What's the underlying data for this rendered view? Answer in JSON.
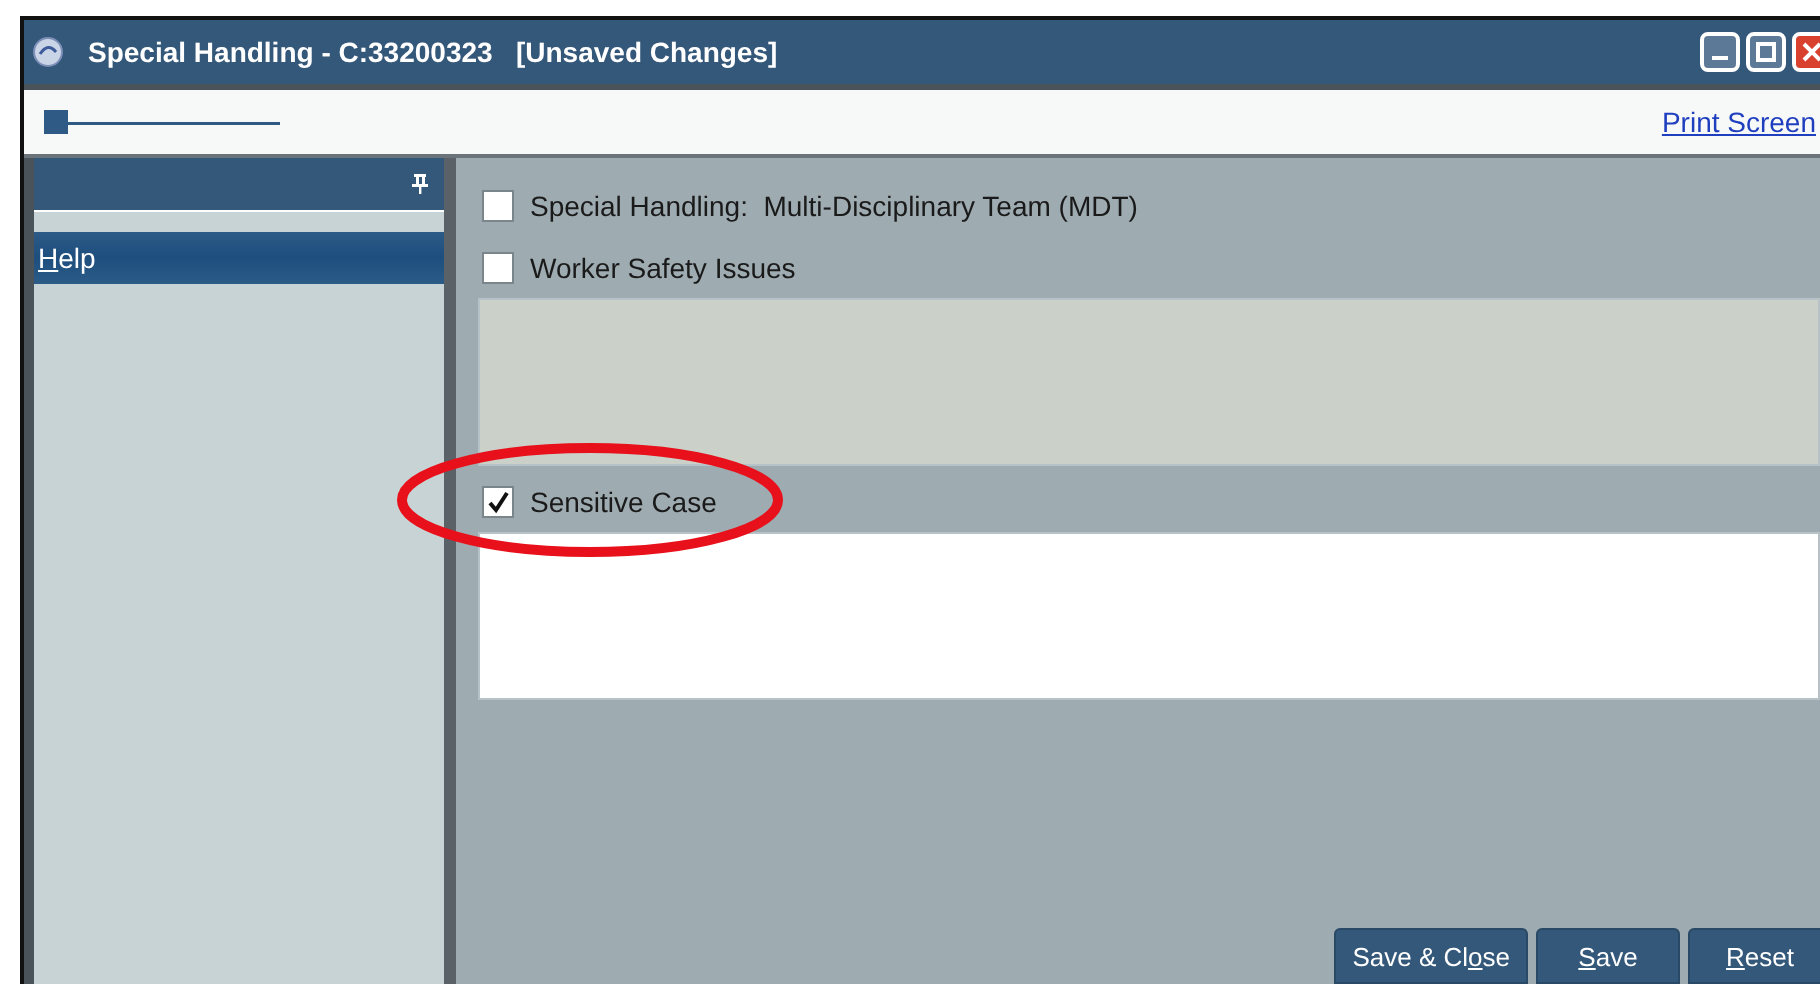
{
  "window": {
    "title": "Special Handling - C:33200323   [Unsaved Changes]"
  },
  "toolbar": {
    "link": "Print Screen"
  },
  "sidebar": {
    "items": [
      {
        "segments": [
          {
            "text": "H",
            "underlined": true
          },
          {
            "text": "elp",
            "underlined": false
          }
        ],
        "selected": true
      }
    ]
  },
  "options": [
    {
      "kind": "checkbox",
      "label": "Special Handling:  Multi-Disciplinary Team (MDT)",
      "checked": false
    },
    {
      "kind": "checkbox",
      "label": "Worker Safety Issues",
      "checked": false
    },
    {
      "kind": "textarea",
      "color": "#cbd0c8"
    },
    {
      "kind": "checkbox",
      "label": "Sensitive Case",
      "checked": true,
      "highlighted": true
    },
    {
      "kind": "textarea",
      "color": "#ffffff"
    }
  ],
  "buttons": [
    {
      "segments": [
        {
          "text": "Save & Cl",
          "underlined": false
        },
        {
          "text": "o",
          "underlined": true
        },
        {
          "text": "se",
          "underlined": false
        }
      ]
    },
    {
      "segments": [
        {
          "text": "S",
          "underlined": true
        },
        {
          "text": "ave",
          "underlined": false
        }
      ]
    },
    {
      "segments": [
        {
          "text": "R",
          "underlined": true
        },
        {
          "text": "eset",
          "underlined": false
        }
      ]
    }
  ]
}
